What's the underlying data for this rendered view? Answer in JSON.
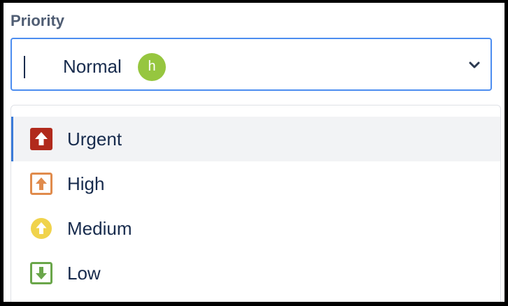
{
  "field": {
    "label": "Priority",
    "selected_value": "Normal",
    "avatar_initial": "h"
  },
  "options": [
    {
      "label": "Urgent",
      "icon": "urgent-icon",
      "color": "#b12a1c"
    },
    {
      "label": "High",
      "icon": "high-icon",
      "color": "#e08b4c"
    },
    {
      "label": "Medium",
      "icon": "medium-icon",
      "color": "#f0d34c"
    },
    {
      "label": "Low",
      "icon": "low-icon",
      "color": "#6aa64a"
    }
  ],
  "colors": {
    "focus_border": "#4c8df0",
    "avatar_bg": "#96c63f",
    "text": "#172b4d"
  }
}
